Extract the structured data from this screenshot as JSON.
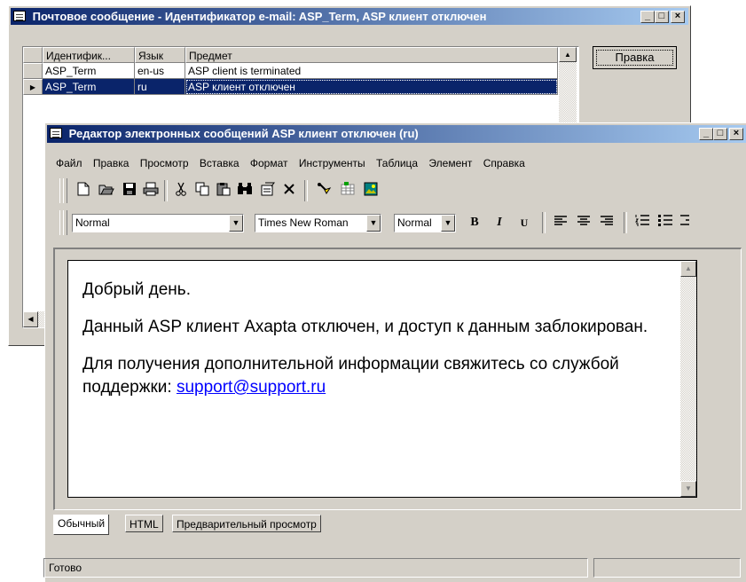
{
  "mail_window": {
    "title": "Почтовое сообщение - Идентификатор e-mail: ASP_Term, ASP клиент отключен",
    "controls": [
      "_",
      "□",
      "×"
    ],
    "columns": [
      "Идентифик...",
      "Язык",
      "Предмет"
    ],
    "rows": [
      {
        "id": "ASP_Term",
        "lang": "en-us",
        "subject": "ASP client is terminated"
      },
      {
        "id": "ASP_Term",
        "lang": "ru",
        "subject": "ASP клиент отключен"
      }
    ],
    "edit_button": "Правка",
    "row_marker": "▶"
  },
  "editor_window": {
    "title": "Редактор электронных сообщений ASP клиент отключен (ru)",
    "controls": [
      "_",
      "□",
      "×"
    ],
    "menu": [
      "Файл",
      "Правка",
      "Просмотр",
      "Вставка",
      "Формат",
      "Инструменты",
      "Таблица",
      "Элемент",
      "Справка"
    ],
    "toolbar_icons": [
      "new-icon",
      "open-icon",
      "save-icon",
      "print-icon",
      "cut-icon",
      "copy-icon",
      "paste-icon",
      "find-icon",
      "properties-icon",
      "delete-icon",
      "highlight-icon",
      "table-icon",
      "image-icon"
    ],
    "style_combo": "Normal",
    "font_combo": "Times New Roman",
    "size_combo": "Normal",
    "format_buttons": {
      "bold": "B",
      "italic": "I",
      "underline": "U"
    },
    "content": {
      "greeting": "Добрый день.",
      "paragraph1": "Данный ASP клиент Axapta отключен, и доступ к данным заблокирован.",
      "paragraph2_prefix": "Для получения дополнительной информации свяжитесь со службой поддержки: ",
      "email_link": "support@support.ru"
    },
    "tabs": [
      "Обычный",
      "HTML",
      "Предварительный просмотр"
    ],
    "active_tab": "Обычный",
    "status": "Готово"
  },
  "colors": {
    "title_active": "#0a246a",
    "title_gradient_end": "#a6caf0",
    "selection": "#0a246a",
    "face": "#d4d0c8",
    "link": "#0000ff"
  }
}
